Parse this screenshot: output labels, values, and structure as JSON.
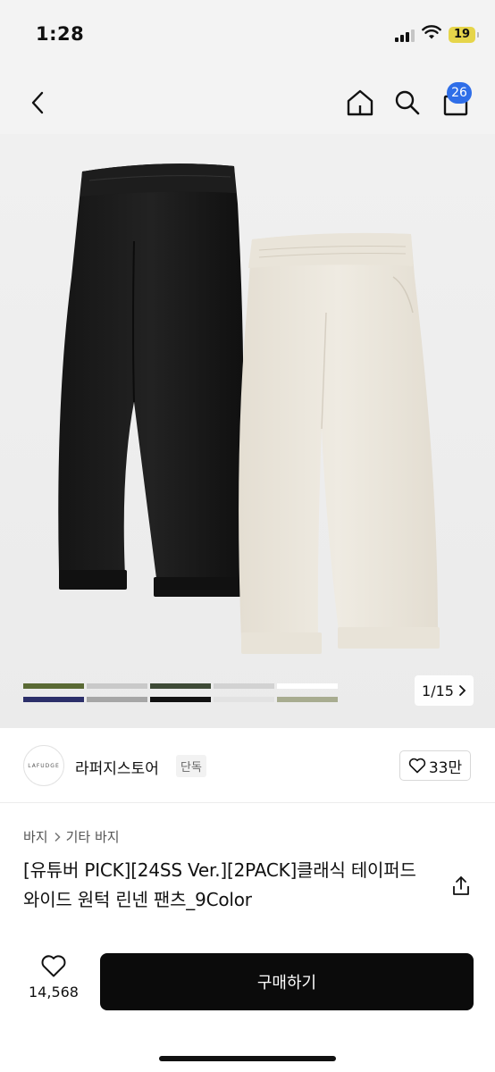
{
  "status": {
    "time": "1:28",
    "battery": "19"
  },
  "nav": {
    "cart_count": "26"
  },
  "gallery": {
    "counter": "1/15",
    "swatch_colors": [
      "#5a6a34",
      "#c9c9c9",
      "#3e4a36",
      "#d2d2d2",
      "#ffffff",
      "#2c2f6a",
      "#a6a6a6",
      "#111111",
      "#e2e2e2",
      "#a8ac90"
    ]
  },
  "store": {
    "logo_text": "LAFUDGE",
    "name": "라퍼지스토어",
    "tag": "단독",
    "likes": "33만"
  },
  "breadcrumb": {
    "level1": "바지",
    "level2": "기타 바지"
  },
  "product": {
    "title": "[유튜버 PICK][24SS Ver.][2PACK]클래식 테이퍼드 와이드 원턱 린넨 팬츠_9Color"
  },
  "bottom": {
    "wish_count": "14,568",
    "buy_label": "구매하기"
  },
  "colors": {
    "accent": "#2f6ee8",
    "buy_bg": "#0b0b0b"
  }
}
